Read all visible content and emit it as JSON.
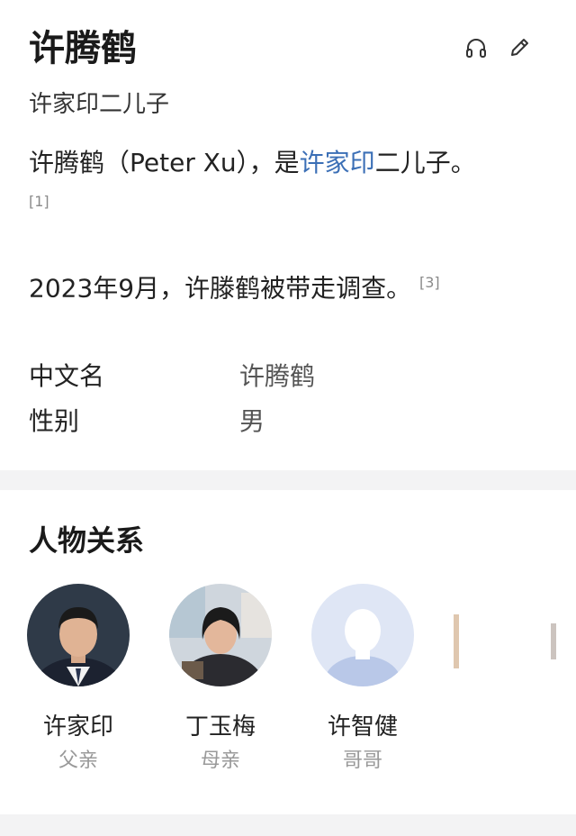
{
  "header": {
    "title": "许腾鹤",
    "subtitle": "许家印二儿子",
    "icons": [
      "headphones-icon",
      "edit-pencil-icon"
    ]
  },
  "intro": {
    "prefix": "许腾鹤（Peter Xu），是",
    "link": "许家印",
    "suffix": "二儿子。",
    "ref": "[1]"
  },
  "news": {
    "text": "2023年9月，许滕鹤被带走调查。",
    "ref": "[3]"
  },
  "info": [
    {
      "key": "中文名",
      "value": "许腾鹤"
    },
    {
      "key": "性别",
      "value": "男"
    }
  ],
  "relations": {
    "title": "人物关系",
    "people": [
      {
        "name": "许家印",
        "relation": "父亲"
      },
      {
        "name": "丁玉梅",
        "relation": "母亲"
      },
      {
        "name": "许智健",
        "relation": "哥哥"
      }
    ]
  },
  "colors": {
    "link": "#3b6fb6",
    "divider": "#f3f3f4",
    "muted": "#999999"
  }
}
